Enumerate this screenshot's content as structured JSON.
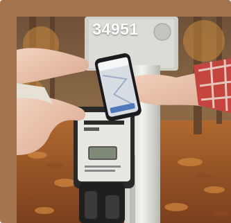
{
  "card": {
    "caption": "34951",
    "frame_color": "#a4744f"
  },
  "image": {
    "icon": "photo-of-ev-charger-and-phone"
  }
}
